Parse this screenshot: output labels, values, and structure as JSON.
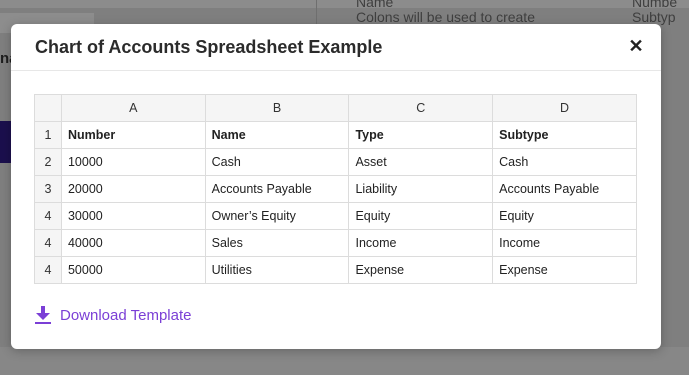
{
  "background": {
    "left_text": "na",
    "name_label": "Name",
    "colon_note": "Colons will be used to create",
    "right_top": "Numbe",
    "right_sub": "Subtyp"
  },
  "modal": {
    "title": "Chart of Accounts Spreadsheet Example",
    "close_icon": "close-icon",
    "download_label": "Download Template",
    "download_icon": "download-icon",
    "accent_color": "#7b3fd6"
  },
  "sheet": {
    "columns": [
      "A",
      "B",
      "C",
      "D"
    ],
    "rows": [
      {
        "num": "1",
        "cells": [
          "Number",
          "Name",
          "Type",
          "Subtype"
        ]
      },
      {
        "num": "2",
        "cells": [
          "10000",
          "Cash",
          "Asset",
          "Cash"
        ]
      },
      {
        "num": "3",
        "cells": [
          "20000",
          "Accounts Payable",
          "Liability",
          "Accounts Payable"
        ]
      },
      {
        "num": "4",
        "cells": [
          "30000",
          "Owner’s Equity",
          "Equity",
          "Equity"
        ]
      },
      {
        "num": "4",
        "cells": [
          "40000",
          "Sales",
          "Income",
          "Income"
        ]
      },
      {
        "num": "4",
        "cells": [
          "50000",
          "Utilities",
          "Expense",
          "Expense"
        ]
      }
    ]
  }
}
